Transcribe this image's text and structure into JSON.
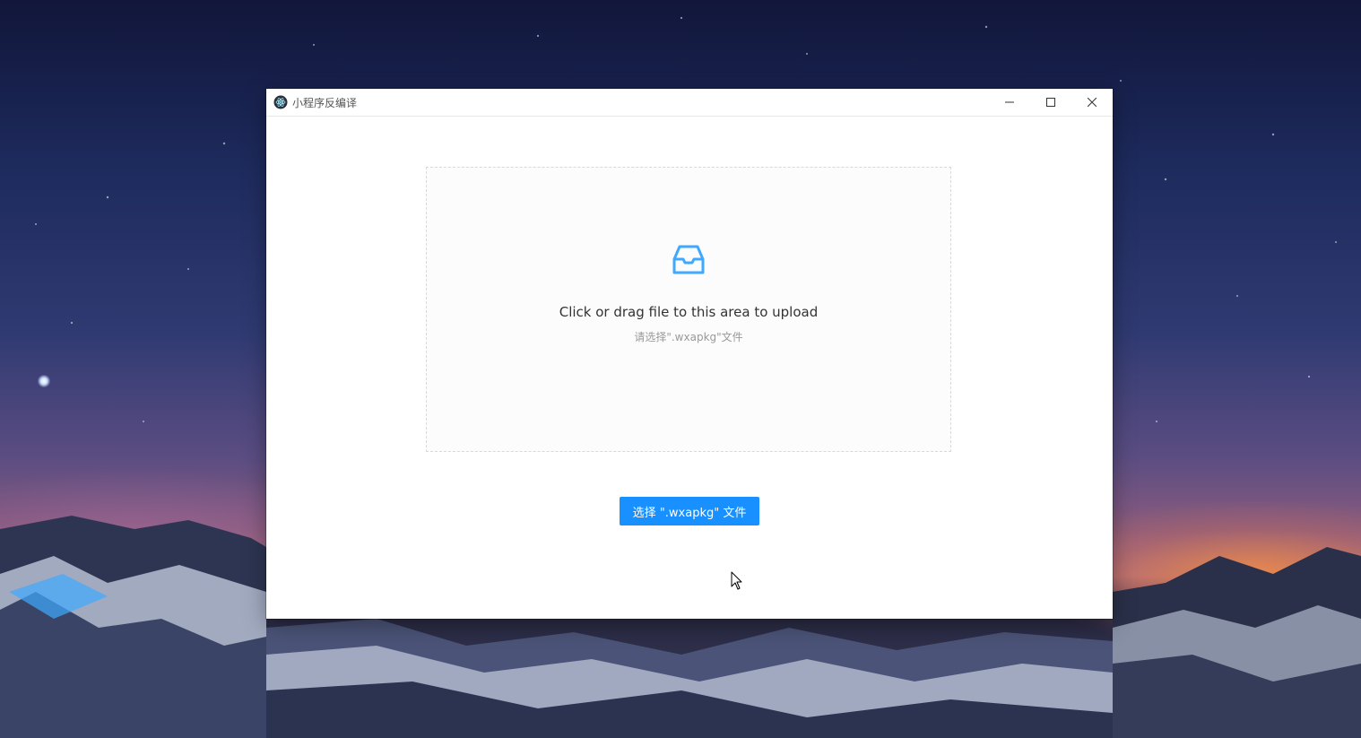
{
  "window": {
    "title": "小程序反编译",
    "icon": "electron-app-icon",
    "controls": {
      "minimize_icon": "minimize-icon",
      "maximize_icon": "maximize-icon",
      "close_icon": "close-icon"
    }
  },
  "upload": {
    "icon": "inbox-icon",
    "title": "Click or drag file to this area to upload",
    "hint": "请选择\".wxapkg\"文件"
  },
  "actions": {
    "select_button": "选择 \".wxapkg\" 文件"
  },
  "colors": {
    "accent": "#1890ff",
    "window_bg": "#ffffff",
    "dropzone_border": "#d9d9d9",
    "title_text": "#333333",
    "hint_text": "#999999"
  }
}
